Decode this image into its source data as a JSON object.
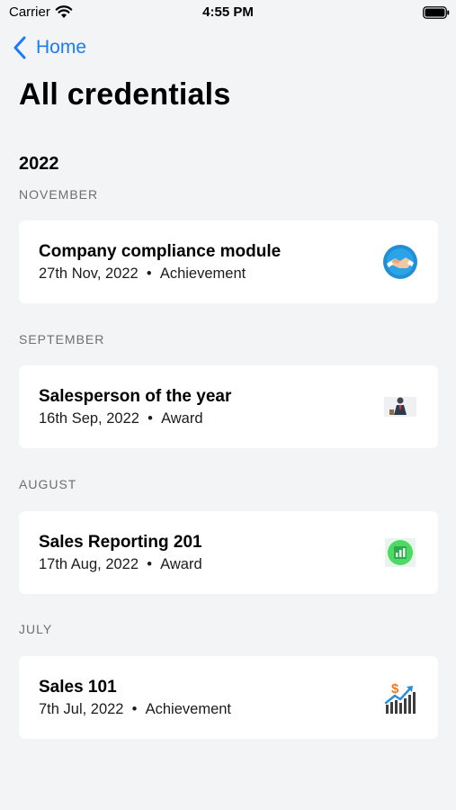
{
  "status_bar": {
    "carrier": "Carrier",
    "time": "4:55 PM"
  },
  "nav": {
    "back_label": "Home"
  },
  "title": "All credentials",
  "year": "2022",
  "sections": [
    {
      "month": "NOVEMBER",
      "card": {
        "title": "Company compliance module",
        "date": "27th Nov, 2022",
        "type": "Achievement",
        "icon": "handshake-icon"
      }
    },
    {
      "month": "SEPTEMBER",
      "card": {
        "title": "Salesperson of the year",
        "date": "16th Sep, 2022",
        "type": "Award",
        "icon": "salesperson-icon"
      }
    },
    {
      "month": "AUGUST",
      "card": {
        "title": "Sales Reporting 201",
        "date": "17th Aug, 2022",
        "type": "Award",
        "icon": "report-chart-icon"
      }
    },
    {
      "month": "JULY",
      "card": {
        "title": "Sales 101",
        "date": "7th Jul, 2022",
        "type": "Achievement",
        "icon": "dollar-growth-chart-icon"
      }
    }
  ],
  "colors": {
    "background": "#f3f4f6",
    "accent": "#1a7cf5",
    "card": "#ffffff",
    "section_label": "#6e6e73"
  }
}
